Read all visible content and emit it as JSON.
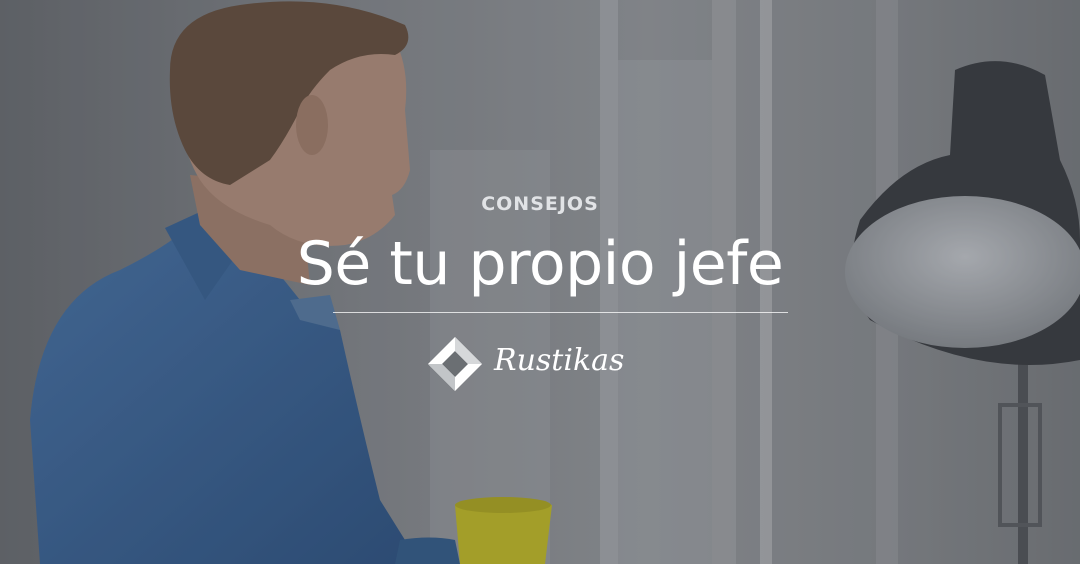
{
  "post": {
    "category": "CONSEJOS",
    "title": "Sé tu propio jefe"
  },
  "brand": {
    "name": "Rustikas",
    "logo_icon": "diamond-logo-icon"
  },
  "colors": {
    "overlay": "#23262c",
    "text": "#ffffff",
    "shirt": "#3d6aa0",
    "mug": "#c7c128"
  }
}
